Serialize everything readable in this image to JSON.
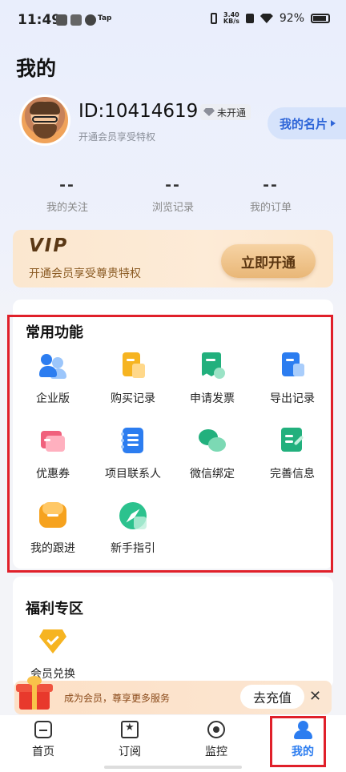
{
  "status_bar": {
    "time": "11:49",
    "net_speed_top": "3.40",
    "net_speed_bottom": "KB/s",
    "battery": "92%",
    "tag": "Tap"
  },
  "page_title": "我的",
  "profile": {
    "user_id": "ID:10414619",
    "vip_status": "未开通",
    "subtitle": "开通会员享受特权",
    "card_button": "我的名片"
  },
  "stats": [
    {
      "value": "--",
      "label": "我的关注"
    },
    {
      "value": "--",
      "label": "浏览记录"
    },
    {
      "value": "--",
      "label": "我的订单"
    }
  ],
  "vip_banner": {
    "logo": "VIP",
    "desc": "开通会员享受尊贵特权",
    "button": "立即开通"
  },
  "common_functions": {
    "title": "常用功能",
    "items": [
      {
        "label": "企业版",
        "icon": "enterprise-icon"
      },
      {
        "label": "购买记录",
        "icon": "purchase-record-icon"
      },
      {
        "label": "申请发票",
        "icon": "invoice-icon"
      },
      {
        "label": "导出记录",
        "icon": "export-record-icon"
      },
      {
        "label": "优惠券",
        "icon": "coupon-icon"
      },
      {
        "label": "项目联系人",
        "icon": "project-contact-icon"
      },
      {
        "label": "微信绑定",
        "icon": "wechat-icon"
      },
      {
        "label": "完善信息",
        "icon": "edit-info-icon"
      },
      {
        "label": "我的跟进",
        "icon": "follow-up-icon"
      },
      {
        "label": "新手指引",
        "icon": "compass-guide-icon"
      }
    ]
  },
  "welfare": {
    "title": "福利专区",
    "items": [
      {
        "label": "会员兑换",
        "icon": "exchange-icon"
      }
    ]
  },
  "promo": {
    "text": "成为会员，尊享更多服务",
    "button": "去充值",
    "close": "✕"
  },
  "tabbar": [
    {
      "label": "首页",
      "icon": "home-icon"
    },
    {
      "label": "订阅",
      "icon": "subscribe-icon"
    },
    {
      "label": "监控",
      "icon": "monitor-icon"
    },
    {
      "label": "我的",
      "icon": "me-icon",
      "active": true
    }
  ],
  "colors": {
    "accent": "#2c7df0",
    "highlight_box": "#e0202a",
    "vip_gold": "#e9b777"
  }
}
